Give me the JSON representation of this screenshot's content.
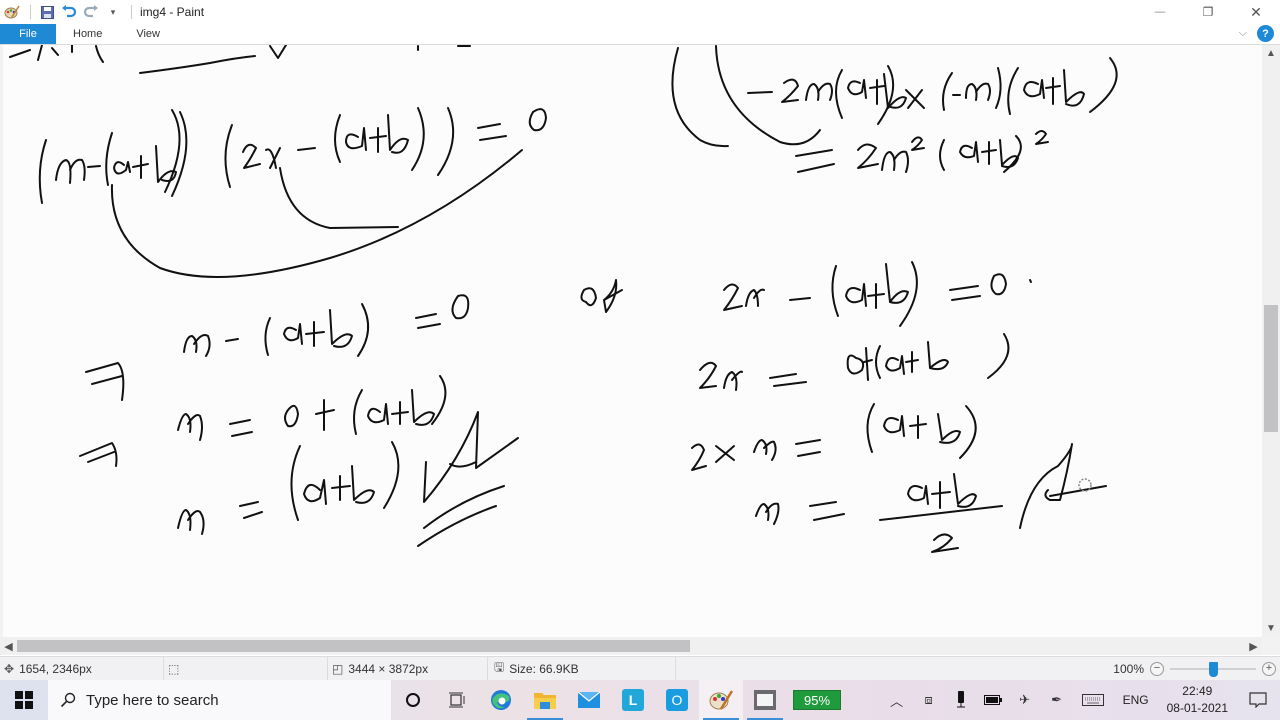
{
  "window": {
    "title": "img4 - Paint",
    "quick_access": [
      "paint-app-icon",
      "save-icon",
      "undo-icon",
      "redo-icon",
      "customize-dropdown-icon"
    ],
    "controls": {
      "minimize": "—",
      "restore": "❐",
      "close": "✕"
    }
  },
  "ribbon": {
    "tabs": [
      {
        "label": "File",
        "active": true
      },
      {
        "label": "Home",
        "active": false
      },
      {
        "label": "View",
        "active": false
      }
    ],
    "help_label": "?"
  },
  "canvas": {
    "content_type": "handwritten math",
    "lines_left": [
      "(x-(a+b))(2x-(a+b)) = 0",
      "x - (a+b) = 0",
      "⇒ x = 0 + (a+b)",
      "⇒ x = (a+b) ✓"
    ],
    "connector_word": "or",
    "lines_right_top": [
      "-2x(a+b) × (-x)(a+b)",
      "= 2x² (a+b)²"
    ],
    "lines_right": [
      "2x - (a+b) = 0",
      "2x = 0+(a+b)",
      "2 × x = (a+b)",
      "x = (a+b)/2 ✓"
    ]
  },
  "statusbar": {
    "cursor_position": "1654, 2346px",
    "selection_size": "",
    "image_dimensions": "3444 × 3872px",
    "file_size": "Size: 66.9KB",
    "zoom_level": "100%",
    "zoom_slider_fraction": 0.5
  },
  "scrollbars": {
    "vertical_position_fraction": 0.5,
    "horizontal_position_fraction": 0.0
  },
  "taskbar": {
    "search_placeholder": "Type here to search",
    "apps": [
      {
        "name": "cortana",
        "icon": "○"
      },
      {
        "name": "task-view",
        "icon": "⧉"
      },
      {
        "name": "edge",
        "icon": "e"
      },
      {
        "name": "file-explorer",
        "icon": "📁"
      },
      {
        "name": "mail",
        "icon": "✉"
      },
      {
        "name": "l-app",
        "icon": "L"
      },
      {
        "name": "o-app",
        "icon": "O"
      },
      {
        "name": "paint",
        "icon": "🎨"
      },
      {
        "name": "camera-app",
        "icon": "▢"
      }
    ],
    "battery_widget": "95%",
    "tray": {
      "language": "ENG",
      "time": "22:49",
      "date": "08-01-2021"
    }
  }
}
